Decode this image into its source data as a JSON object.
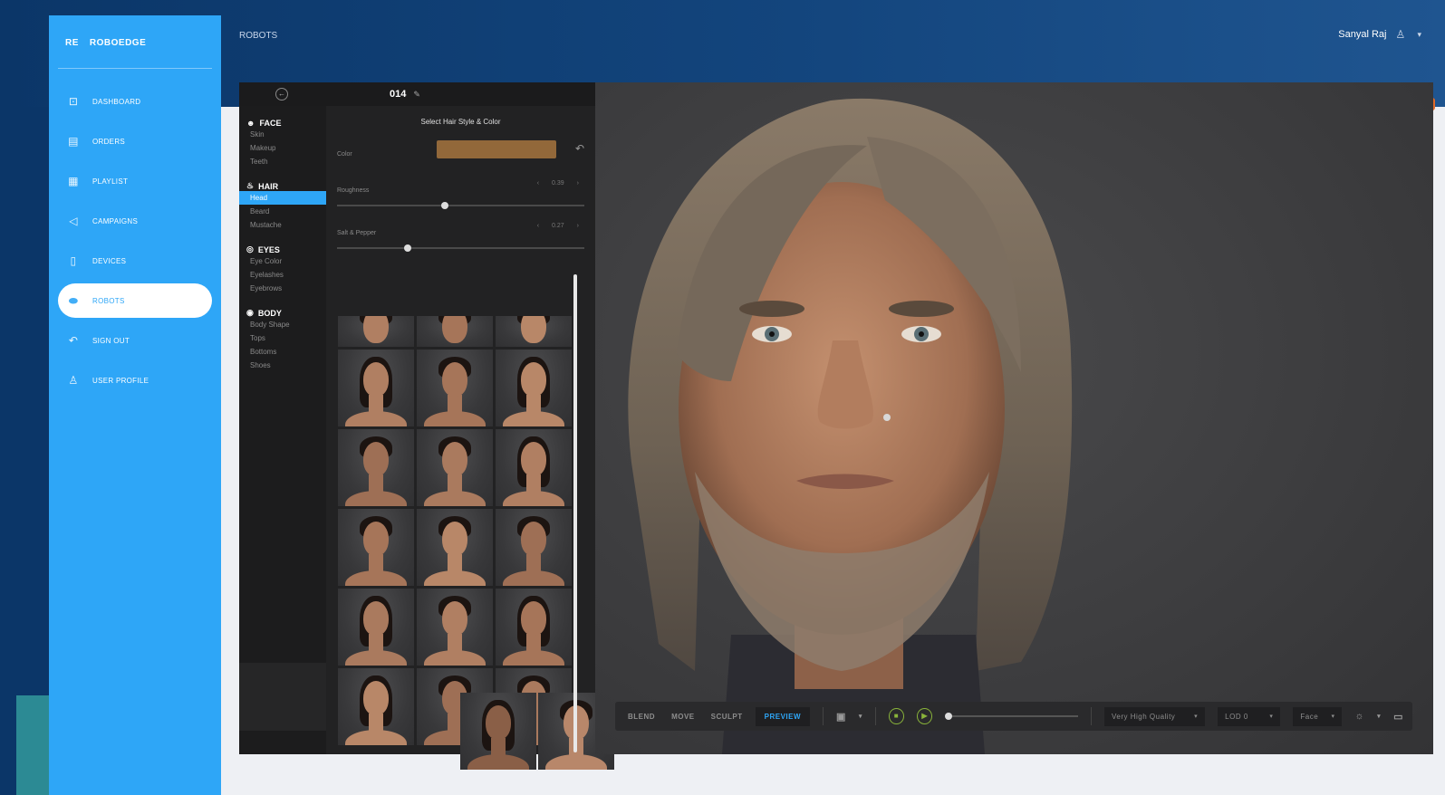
{
  "header": {
    "page_title": "ROBOTS",
    "user_name": "Sanyal Raj"
  },
  "sidebar": {
    "brand": "ROBOEDGE",
    "items": [
      {
        "label": "DASHBOARD",
        "icon": "dashboard-icon",
        "glyph": "⊡"
      },
      {
        "label": "ORDERS",
        "icon": "orders-icon",
        "glyph": "▤"
      },
      {
        "label": "PLAYLIST",
        "icon": "playlist-icon",
        "glyph": "▦"
      },
      {
        "label": "CAMPAIGNS",
        "icon": "campaigns-icon",
        "glyph": "◁"
      },
      {
        "label": "DEVICES",
        "icon": "devices-icon",
        "glyph": "▯"
      },
      {
        "label": "ROBOTS",
        "icon": "robots-icon",
        "glyph": "⬬"
      },
      {
        "label": "SIGN OUT",
        "icon": "signout-icon",
        "glyph": "↶"
      },
      {
        "label": "USER PROFILE",
        "icon": "user-icon",
        "glyph": "♙"
      }
    ]
  },
  "editor": {
    "title_number": "014",
    "panel_title": "Select Hair Style & Color",
    "categories": [
      {
        "name": "FACE",
        "items": [
          "Skin",
          "Makeup",
          "Teeth"
        ]
      },
      {
        "name": "HAIR",
        "items": [
          "Head",
          "Beard",
          "Mustache"
        ]
      },
      {
        "name": "EYES",
        "items": [
          "Eye Color",
          "Eyelashes",
          "Eyebrows"
        ]
      },
      {
        "name": "BODY",
        "items": [
          "Body Shape",
          "Tops",
          "Bottoms",
          "Shoes"
        ]
      }
    ],
    "color_label": "Color",
    "color_value": "#92683a",
    "roughness": {
      "label": "Roughness",
      "value": "0.39",
      "level": 0.42
    },
    "salt_pepper": {
      "label": "Salt & Pepper",
      "value": "0.27",
      "level": 0.27
    }
  },
  "toolbar": {
    "modes": [
      "BLEND",
      "MOVE",
      "SCULPT",
      "PREVIEW"
    ],
    "active_mode": "PREVIEW",
    "quality": "Very High Quality",
    "lod": "LOD 0",
    "view": "Face"
  }
}
